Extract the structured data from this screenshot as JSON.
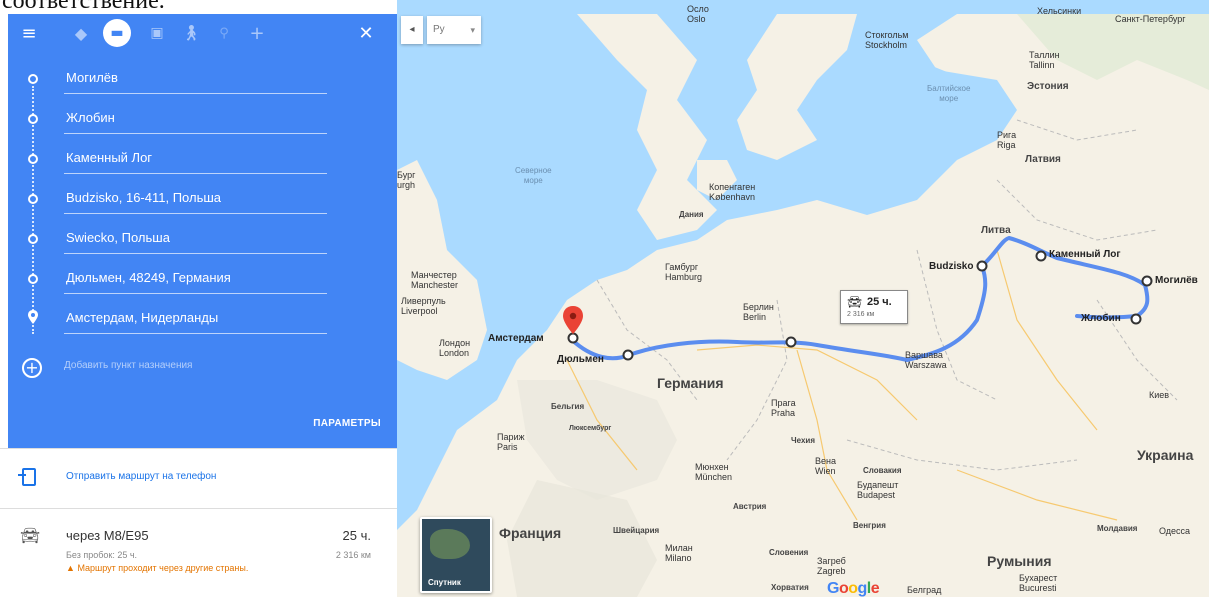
{
  "top_caption": "соответствение.",
  "modes": [
    {
      "icon": "menu-icon",
      "label": "Меню"
    },
    {
      "icon": "directions-icon",
      "label": "Маршрут"
    },
    {
      "icon": "car-icon",
      "label": "Автомобиль"
    },
    {
      "icon": "transit-icon",
      "label": "Транспорт"
    },
    {
      "icon": "walk-icon",
      "label": "Пешком"
    },
    {
      "icon": "bike-icon",
      "label": "Велосипед"
    },
    {
      "icon": "flight-icon",
      "label": "Самолёт"
    },
    {
      "icon": "close-icon",
      "label": "Закрыть"
    }
  ],
  "stops": [
    "Могилёв",
    "Жлобин",
    "Каменный Лог",
    "Budzisko, 16-411, Польша",
    "Swiecko, Польша",
    "Дюльмен, 48249, Германия",
    "Амстердам, Нидерланды"
  ],
  "add_destination_placeholder": "Добавить пункт назначения",
  "params_label": "ПАРАМЕТРЫ",
  "send_to_phone": "Отправить маршрут на телефон",
  "route": {
    "via": "через M8/E95",
    "duration": "25 ч.",
    "no_traffic": "Без пробок: 25 ч.",
    "distance": "2 316 км",
    "warning": "Маршрут проходит через другие страны."
  },
  "map": {
    "lang_select": "Ру",
    "satellite_label": "Спутник",
    "route_pill": {
      "duration": "25 ч.",
      "distance": "2 316 км"
    },
    "countries": [
      "Германия",
      "Украина",
      "Румыния",
      "Литва",
      "Латвия",
      "Эстония",
      "Франция"
    ],
    "cities": {
      "amsterdam": "Амстердам",
      "dulmen": "Дюльмен",
      "budzisko": "Budzisko",
      "kamenny_log": "Каменный Лог",
      "mogilev": "Могилёв",
      "zhlobin": "Жлобин"
    },
    "labels": {
      "oslo": "Осло\nOslo",
      "stockholm": "Стокгольм\nStockholm",
      "helsinki": "Хельсинки",
      "spb": "Санкт-Петербург",
      "tallinn": "Таллин\nTallinn",
      "baltic": "Балтийское\nморе",
      "riga": "Рига\nRiga",
      "north_sea": "Северное\nморе",
      "copenhagen": "Копенгаген\nKøbenhavn",
      "denmark": "Дания",
      "manchester": "Манчестер\nManchester",
      "liverpool": "Ливерпуль\nLiverpool",
      "london": "Лондон\nLondon",
      "hamburg": "Гамбург\nHamburg",
      "berlin": "Берлин\nBerlin",
      "warsaw": "Варшава\nWarszawa",
      "belgium": "Бельгия",
      "luxembourg": "Люксембург",
      "paris": "Париж\nParis",
      "prague": "Прага\nPraha",
      "czech": "Чехия",
      "vienna": "Вена\nWien",
      "slovakia": "Словакия",
      "budapest": "Будапешт\nBudapest",
      "munich": "Мюнхен\nMünchen",
      "austria": "Австрия",
      "switzerland": "Швейцария",
      "milan": "Милан\nMilano",
      "slovenia": "Словения",
      "zagreb": "Загреб\nZagreb",
      "hungary": "Венгрия",
      "croatia": "Хорватия",
      "belgrade": "Белград",
      "kyiv": "Киев",
      "moldova": "Молдавия",
      "odessa": "Одесса",
      "bucharest": "Бухарест\nBucuresti",
      "gb_left": "Бург\nurgh"
    }
  },
  "colors": {
    "panel_blue": "#4285f4",
    "route_line": "#5b8def",
    "sea": "#aadaff",
    "land": "#f5f1e6"
  }
}
